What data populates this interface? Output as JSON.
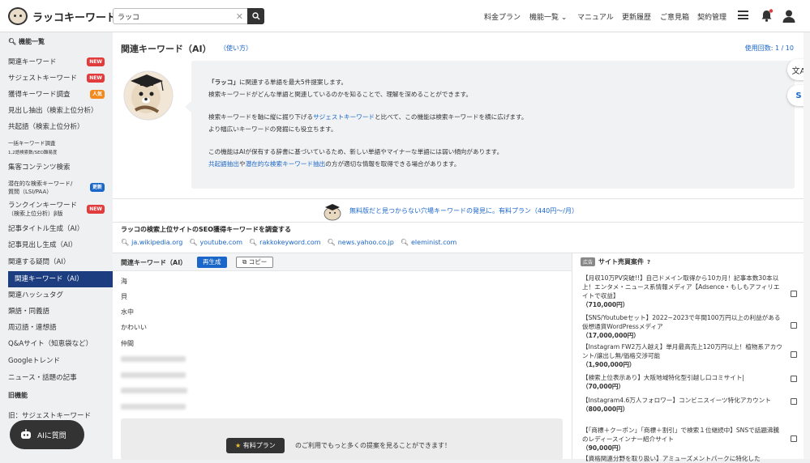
{
  "app": {
    "logo_text": "ラッコキーワード"
  },
  "search": {
    "value": "ラッコ",
    "clear": "✕"
  },
  "nav": [
    "料金プラン",
    "機能一覧",
    "マニュアル",
    "更新履歴",
    "ご意見箱",
    "契約管理"
  ],
  "sidebar": {
    "head": "機能一覧",
    "items": [
      {
        "label": "関連キーワード",
        "badge": "NEW",
        "badge_color": "#e23b3b"
      },
      {
        "label": "サジェストキーワード",
        "badge": "NEW",
        "badge_color": "#e23b3b"
      },
      {
        "label": "獲得キーワード調査",
        "badge": "人気",
        "badge_color": "#f28a1e"
      },
      {
        "label": "見出し抽出（検索上位分析）"
      },
      {
        "label": "共起語（検索上位分析）"
      },
      {
        "label": "一括キーワード調査",
        "sub": "1,2語検索数/SEO難易度"
      },
      {
        "label": "集客コンテンツ検索"
      },
      {
        "label": "潜在的な検索キーワード/",
        "sub": "質問（LSI/PAA）",
        "badge": "更新",
        "badge_color": "#1a66c9"
      },
      {
        "label": "ランクインキーワード",
        "sub": "（検索上位分析）β版",
        "badge": "NEW",
        "badge_color": "#e23b3b"
      },
      {
        "label": "記事タイトル生成（AI）"
      },
      {
        "label": "記事見出し生成（AI）"
      },
      {
        "label": "関連する疑問（AI）"
      },
      {
        "label": "関連キーワード（AI）"
      },
      {
        "label": "関連ハッシュタグ"
      },
      {
        "label": "類語・同義語"
      },
      {
        "label": "周辺語・連想語"
      },
      {
        "label": "Q&Aサイト（知恵袋など）"
      },
      {
        "label": "Googleトレンド"
      },
      {
        "label": "ニュース・話題の記事"
      }
    ],
    "section2": "旧機能",
    "old_item": "旧：サジェストキーワード"
  },
  "main": {
    "title": "関連キーワード（AI）",
    "howto": "（使い方）",
    "usage": "使用回数: 1 / 10",
    "desc1a": "「ラッコ」",
    "desc1b": "に関連する単語を最大5件提案します。",
    "desc2": "検索キーワードがどんな単語と関連しているのかを知ることで、理解を深めることができます。",
    "desc3a": "検索キーワードを軸に縦に掘り下げる",
    "desc3link": "サジェストキーワード",
    "desc3b": "と比べて、この機能は検索キーワードを横に広げます。",
    "desc4": "より幅広いキーワードの発掘にも役立ちます。",
    "desc5": "この機能はAIが保有する辞書に基づいているため、新しい単語やマイナーな単語には弱い傾向があります。",
    "desc6link1": "共起語抽出",
    "desc6mid": "や",
    "desc6link2": "潜在的な検索キーワード抽出",
    "desc6b": "の方が適切な情報を取得できる場合があります。",
    "promo": "無料版だと見つからない穴場キーワードの発見に。有料プラン（440円〜/月）",
    "seo_title": "ラッコの検索上位サイトのSEO獲得キーワードを調査する",
    "sites": [
      "ja.wikipedia.org",
      "youtube.com",
      "rakkokeyword.com",
      "news.yahoo.co.jp",
      "eleminist.com"
    ]
  },
  "keywords": {
    "title": "関連キーワード（AI）",
    "regen": "再生成",
    "copy": "コピー",
    "items": [
      "海",
      "貝",
      "水中",
      "かわいい",
      "仲間"
    ],
    "paid_button": "有料プラン",
    "paid_note": "のご利用でもっと多くの提案を見ることができます！"
  },
  "ads": {
    "tag": "広告",
    "title": "サイト売買案件",
    "items": [
      {
        "text": "【月収10万PV突破!!】自己ドメイン取得から10カ月！記事本数30本以上！エンタメ・ニュース系情報メディア【Adsence・もしもアフィリエイトで収益】",
        "price": "（710,000円）"
      },
      {
        "text": "【SNS/Youtubeセット】2022~2023で年間100万円以上の利益がある仮想通貨WordPressメディア",
        "price": "（17,000,000円）"
      },
      {
        "text": "【Instagram FW2万人越え】単月最高売上120万円以上！植物系アカウント/譲出し無/価格交渉可能",
        "price": "（1,900,000円）"
      },
      {
        "text": "【検索上位表示あり】大阪地域特化型引越し口コミサイト|",
        "price": "（70,000円）"
      },
      {
        "text": "【Instagram4.6万人フォロワー】コンビニスイーツ特化アカウント",
        "price": "（800,000円）"
      },
      {
        "text": "【「商標＋クーポン」「商標＋割引」で検索１位継続中】SNSで話題沸騰のレディースインナー紹介サイト",
        "price": "（90,000円）"
      },
      {
        "text": "【資格関連分野を取り扱い】アミューズメントパークに特化した",
        "price": ""
      }
    ]
  },
  "ai_button": "AIに質問",
  "colors": {
    "accent": "#1a66c9",
    "active": "#1c3e80",
    "badge_new": "#e23b3b"
  }
}
